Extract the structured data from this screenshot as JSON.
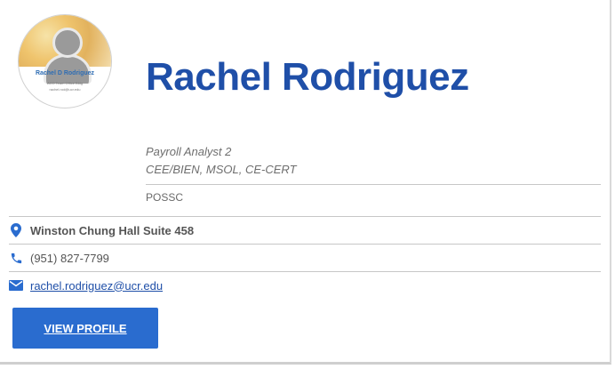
{
  "colors": {
    "accent": "#1f4fa8",
    "button": "#2a6ccf",
    "icon": "#2a6ccf"
  },
  "avatar": {
    "name": "Rachel D Rodriguez",
    "sub_line1": "ACO Team Office Bldg",
    "sub_line2": "rachel.rod@ucr.edu"
  },
  "profile": {
    "name": "Rachel Rodriguez",
    "title": "Payroll Analyst 2",
    "credentials": "CEE/BIEN, MSOL, CE-CERT",
    "department": "POSSC"
  },
  "contact": {
    "address": "Winston Chung Hall Suite 458",
    "phone": "(951) 827-7799",
    "email": "rachel.rodriguez@ucr.edu"
  },
  "actions": {
    "view_profile": "VIEW PROFILE"
  },
  "icons": {
    "location": "map-pin-icon",
    "phone": "phone-icon",
    "email": "envelope-icon"
  }
}
